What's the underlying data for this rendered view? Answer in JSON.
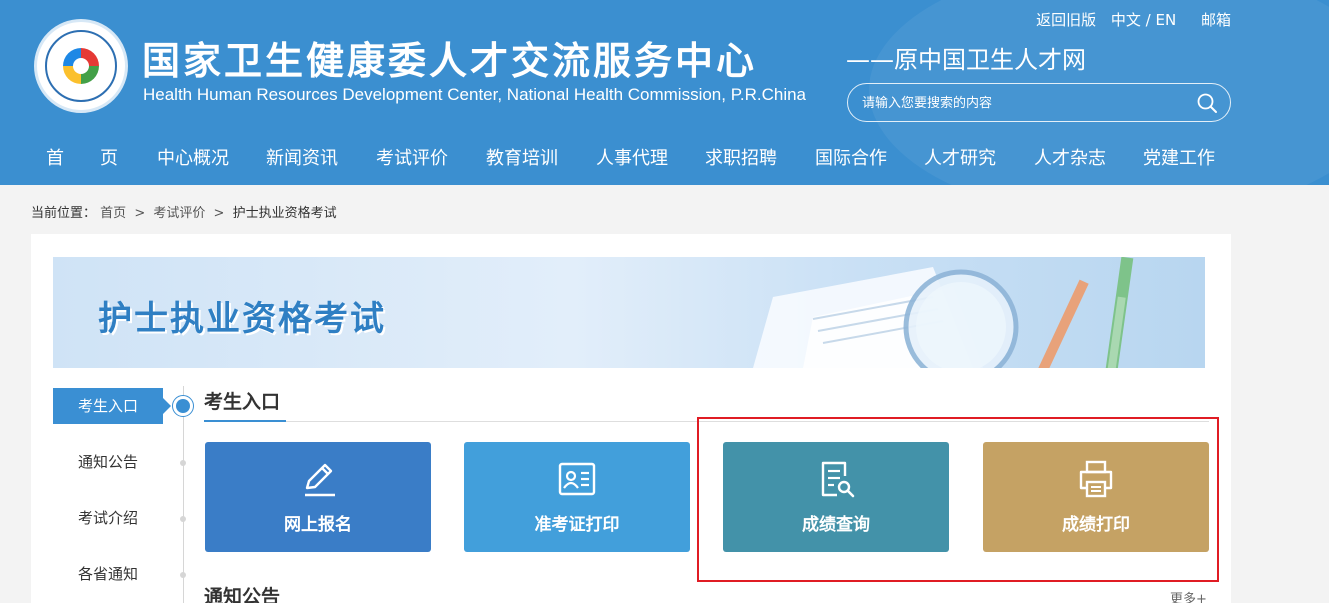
{
  "header": {
    "title": "国家卫生健康委人才交流服务中心",
    "subtitle_en": "Health Human Resources Development Center, National Health Commission, P.R.China",
    "slogan": "——原中国卫生人才网",
    "top_links": {
      "old_version": "返回旧版",
      "language": "中文 / EN",
      "mail": "邮箱"
    },
    "search": {
      "placeholder": "请输入您要搜索的内容",
      "value": ""
    },
    "logo_text": "国家卫生健康委人才交流服务中心"
  },
  "nav": {
    "items": [
      "首　　页",
      "中心概况",
      "新闻资讯",
      "考试评价",
      "教育培训",
      "人事代理",
      "求职招聘",
      "国际合作",
      "人才研究",
      "人才杂志",
      "党建工作"
    ]
  },
  "breadcrumb": {
    "prefix": "当前位置：",
    "items": [
      "首页",
      "考试评价",
      "护士执业资格考试"
    ],
    "separator": ">"
  },
  "banner": {
    "title": "护士执业资格考试"
  },
  "sidebar": {
    "items": [
      "考生入口",
      "通知公告",
      "考试介绍",
      "各省通知"
    ],
    "active_index": 0
  },
  "main": {
    "section_title": "考生入口",
    "tiles": [
      {
        "label": "网上报名",
        "icon": "pen-icon",
        "color": "#3a7dc7"
      },
      {
        "label": "准考证打印",
        "icon": "id-card-icon",
        "color": "#429fdb"
      },
      {
        "label": "成绩查询",
        "icon": "document-search-icon",
        "color": "#4392a9"
      },
      {
        "label": "成绩打印",
        "icon": "printer-icon",
        "color": "#c5a264"
      }
    ],
    "notice_title": "通知公告",
    "more_label": "更多+"
  },
  "colors": {
    "header_bg": "#3b8fd0",
    "accent": "#3a8fd3",
    "highlight_border": "#e01c24"
  }
}
